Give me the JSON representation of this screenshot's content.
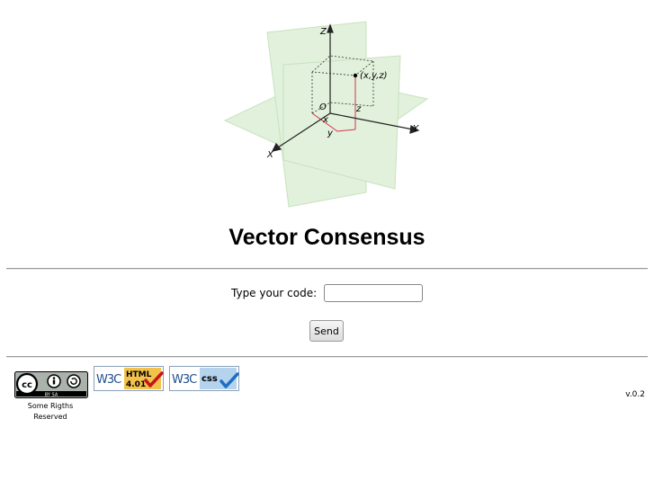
{
  "logo": {
    "axis_z": "Z",
    "axis_y": "Y",
    "axis_x": "X",
    "origin": "O",
    "point": "(x,y,z)",
    "comp_x": "x",
    "comp_y": "y",
    "comp_z": "z"
  },
  "header": {
    "title": "Vector Consensus"
  },
  "form": {
    "code_label": "Type your code:",
    "code_value": "",
    "code_placeholder": "",
    "send_label": "Send"
  },
  "footer": {
    "license_caption_line1": "Some Rigths",
    "license_caption_line2": "Reserved",
    "cc_badge_text": "BY   SA",
    "w3c_html_brand": "W3C",
    "w3c_html_label": "HTML",
    "w3c_html_version": "4.01",
    "w3c_css_brand": "W3C",
    "w3c_css_label": "css",
    "version": "v.0.2"
  },
  "colors": {
    "plane_fill": "#c9e6bf",
    "plane_stroke": "#9ccc8e",
    "vector_red": "#d8344b",
    "html_badge_bg": "#f3c24a",
    "css_badge_bg": "#b5d3ec",
    "check_red": "#c4161c",
    "check_blue": "#1e6fc2"
  },
  "icons": [
    "coordinate-logo",
    "cc-license-icon",
    "w3c-html-check-icon",
    "w3c-css-check-icon"
  ]
}
